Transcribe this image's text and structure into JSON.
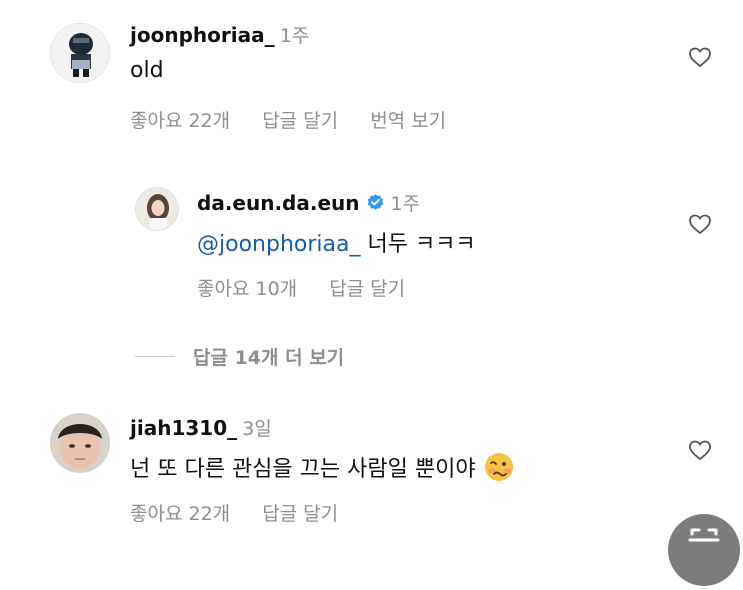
{
  "comments": [
    {
      "username": "joonphoriaa_",
      "time": "1주",
      "text": "old",
      "likes": "좋아요 22개",
      "reply": "답글 달기",
      "translate": "번역 보기"
    },
    {
      "username": "da.eun.da.eun",
      "time": "1주",
      "mention": "@joonphoriaa_",
      "text": "너두 ㅋㅋㅋ",
      "likes": "좋아요 10개",
      "reply": "답글 달기"
    },
    {
      "username": "jiah1310_",
      "time": "3일",
      "text": "넌 또 다른 관심을 끄는 사람일 뿐이야",
      "likes": "좋아요 22개",
      "reply": "답글 달기"
    }
  ],
  "view_replies": "답글 14개 더 보기",
  "icons": {
    "heart": "heart-icon",
    "verified": "verified-badge-icon",
    "emoji": "woozy-face-emoji-icon"
  },
  "colors": {
    "mention": "#1a5ca8",
    "muted": "#8e8e8e",
    "verified": "#3897f0"
  }
}
